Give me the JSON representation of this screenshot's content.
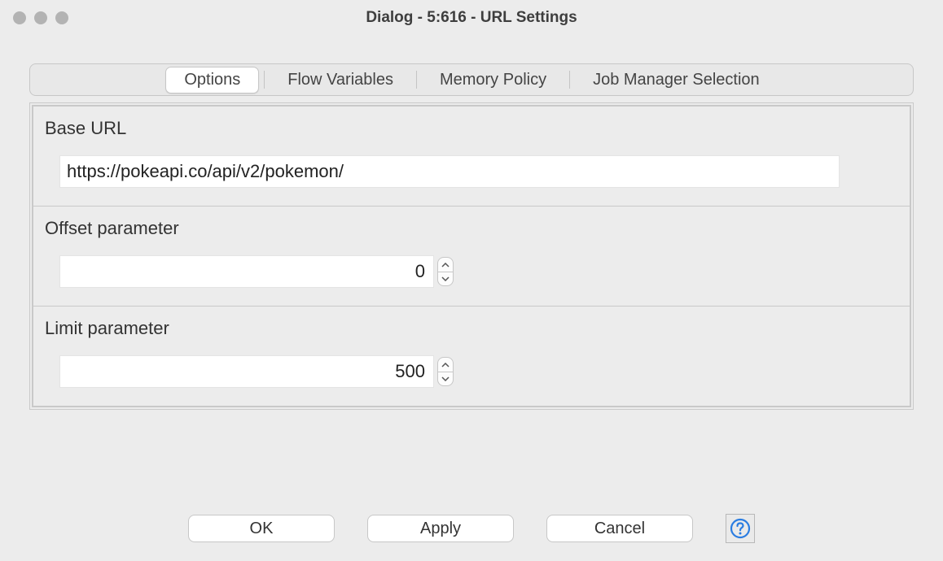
{
  "window": {
    "title": "Dialog - 5:616 - URL Settings"
  },
  "tabs": {
    "options": "Options",
    "flow_variables": "Flow Variables",
    "memory_policy": "Memory Policy",
    "job_manager": "Job Manager Selection"
  },
  "form": {
    "base_url": {
      "label": "Base URL",
      "value": "https://pokeapi.co/api/v2/pokemon/"
    },
    "offset": {
      "label": "Offset parameter",
      "value": "0"
    },
    "limit": {
      "label": "Limit parameter",
      "value": "500"
    }
  },
  "buttons": {
    "ok": "OK",
    "apply": "Apply",
    "cancel": "Cancel"
  }
}
